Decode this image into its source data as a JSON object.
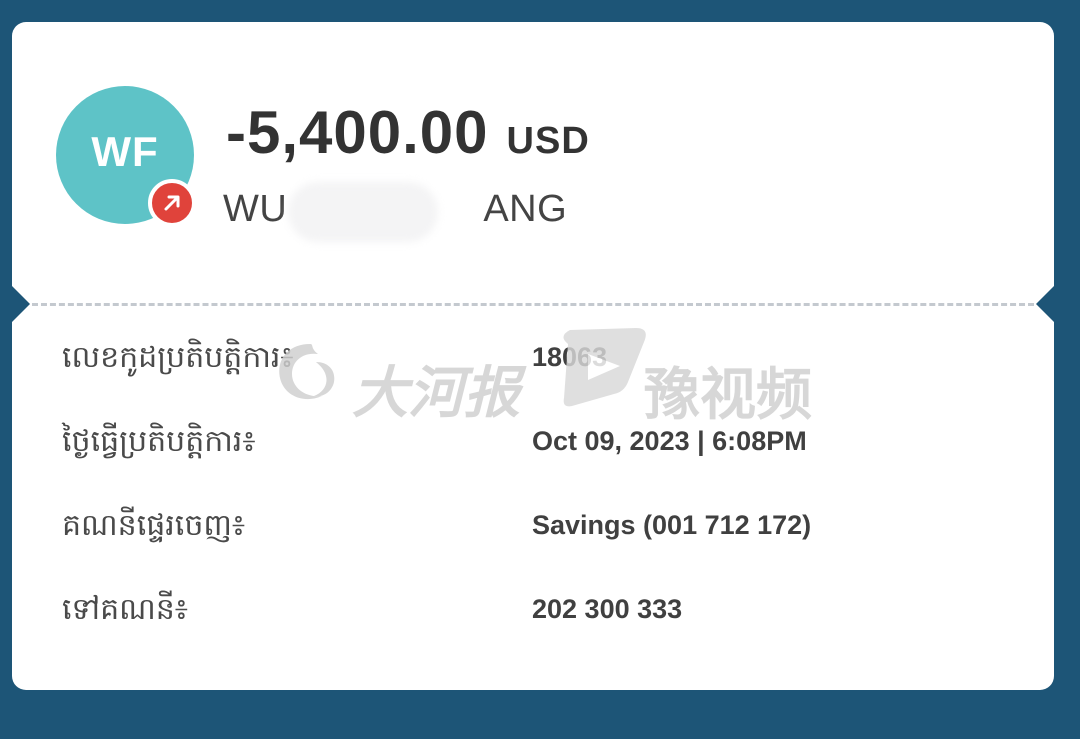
{
  "transaction": {
    "avatar_initials": "WF",
    "direction_icon": "arrow-up-right-icon",
    "amount": "-5,400.00",
    "currency": "USD",
    "counterparty_prefix": "WU",
    "counterparty_suffix": "ANG"
  },
  "details": [
    {
      "label": "លេខកូដប្រតិបត្តិការ៖",
      "value": "18063"
    },
    {
      "label": "ថ្ងៃធ្វើប្រតិបត្តិការ៖",
      "value": "Oct 09, 2023 | 6:08PM"
    },
    {
      "label": "គណនីផ្ទេរចេញ៖",
      "value": "Savings (001 712 172)"
    },
    {
      "label": "ទៅគណនី៖",
      "value": "202 300 333"
    }
  ],
  "watermark": {
    "left_text": "大河报",
    "right_text": "豫视频"
  },
  "colors": {
    "background": "#1d5577",
    "card": "#ffffff",
    "avatar": "#5ec3c7",
    "badge": "#e0433b"
  }
}
